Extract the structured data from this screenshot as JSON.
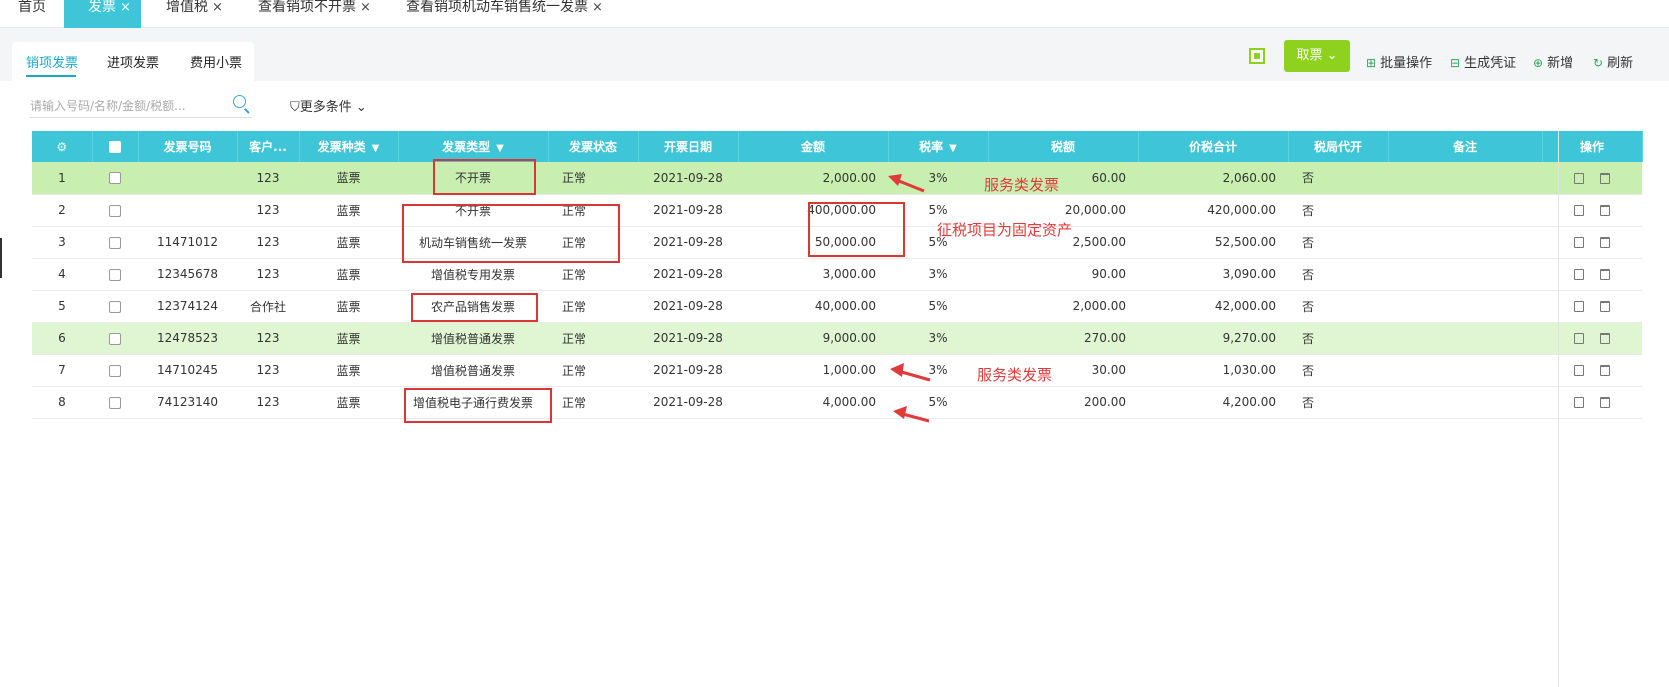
{
  "top_tabs": [
    {
      "label": "首页",
      "close": ""
    },
    {
      "label": "发票",
      "close": "×"
    },
    {
      "label": "增值税",
      "close": "×"
    },
    {
      "label": "查看销项不开票",
      "close": "×"
    },
    {
      "label": "查看销项机动车销售统一发票",
      "close": "×"
    }
  ],
  "sub_tabs": [
    "销项发票",
    "进项发票",
    "费用小票"
  ],
  "toolbar": {
    "qu_label": "取票",
    "batch": "批量操作",
    "voucher": "生成凭证",
    "add": "新增",
    "refresh": "刷新"
  },
  "search": {
    "placeholder": "请输入号码/名称/金额/税额..."
  },
  "more_conditions": "更多条件",
  "columns": [
    "",
    "",
    "发票号码",
    "客户...",
    "发票种类",
    "发票类型",
    "发票状态",
    "开票日期",
    "金额",
    "税率",
    "税额",
    "价税合计",
    "税局代开",
    "备注",
    "操作"
  ],
  "rows": [
    {
      "idx": "1",
      "num": "",
      "cust": "123",
      "kind": "蓝票",
      "type": "不开票",
      "status": "正常",
      "date": "2021-09-28",
      "amount": "2,000.00",
      "rate": "3%",
      "tax": "60.00",
      "total": "2,060.00",
      "agent": "否"
    },
    {
      "idx": "2",
      "num": "",
      "cust": "123",
      "kind": "蓝票",
      "type": "不开票",
      "status": "正常",
      "date": "2021-09-28",
      "amount": "400,000.00",
      "rate": "5%",
      "tax": "20,000.00",
      "total": "420,000.00",
      "agent": "否"
    },
    {
      "idx": "3",
      "num": "11471012",
      "cust": "123",
      "kind": "蓝票",
      "type": "机动车销售统一发票",
      "status": "正常",
      "date": "2021-09-28",
      "amount": "50,000.00",
      "rate": "5%",
      "tax": "2,500.00",
      "total": "52,500.00",
      "agent": "否"
    },
    {
      "idx": "4",
      "num": "12345678",
      "cust": "123",
      "kind": "蓝票",
      "type": "增值税专用发票",
      "status": "正常",
      "date": "2021-09-28",
      "amount": "3,000.00",
      "rate": "3%",
      "tax": "90.00",
      "total": "3,090.00",
      "agent": "否"
    },
    {
      "idx": "5",
      "num": "12374124",
      "cust": "合作社",
      "kind": "蓝票",
      "type": "农产品销售发票",
      "status": "正常",
      "date": "2021-09-28",
      "amount": "40,000.00",
      "rate": "5%",
      "tax": "2,000.00",
      "total": "42,000.00",
      "agent": "否"
    },
    {
      "idx": "6",
      "num": "12478523",
      "cust": "123",
      "kind": "蓝票",
      "type": "增值税普通发票",
      "status": "正常",
      "date": "2021-09-28",
      "amount": "9,000.00",
      "rate": "3%",
      "tax": "270.00",
      "total": "9,270.00",
      "agent": "否"
    },
    {
      "idx": "7",
      "num": "14710245",
      "cust": "123",
      "kind": "蓝票",
      "type": "增值税普通发票",
      "status": "正常",
      "date": "2021-09-28",
      "amount": "1,000.00",
      "rate": "3%",
      "tax": "30.00",
      "total": "1,030.00",
      "agent": "否"
    },
    {
      "idx": "8",
      "num": "74123140",
      "cust": "123",
      "kind": "蓝票",
      "type": "增值税电子通行费发票",
      "status": "正常",
      "date": "2021-09-28",
      "amount": "4,000.00",
      "rate": "5%",
      "tax": "200.00",
      "total": "4,200.00",
      "agent": "否"
    }
  ],
  "annotations": {
    "service1": "服务类发票",
    "fixed_asset": "征税项目为固定资产",
    "service2": "服务类发票"
  },
  "colors": {
    "header": "#3ec5d8",
    "row_highlight": "#c9efb0",
    "row_highlight2": "#e0f6d2",
    "accent_green": "#8ed21f",
    "annotation_red": "#d93636"
  }
}
